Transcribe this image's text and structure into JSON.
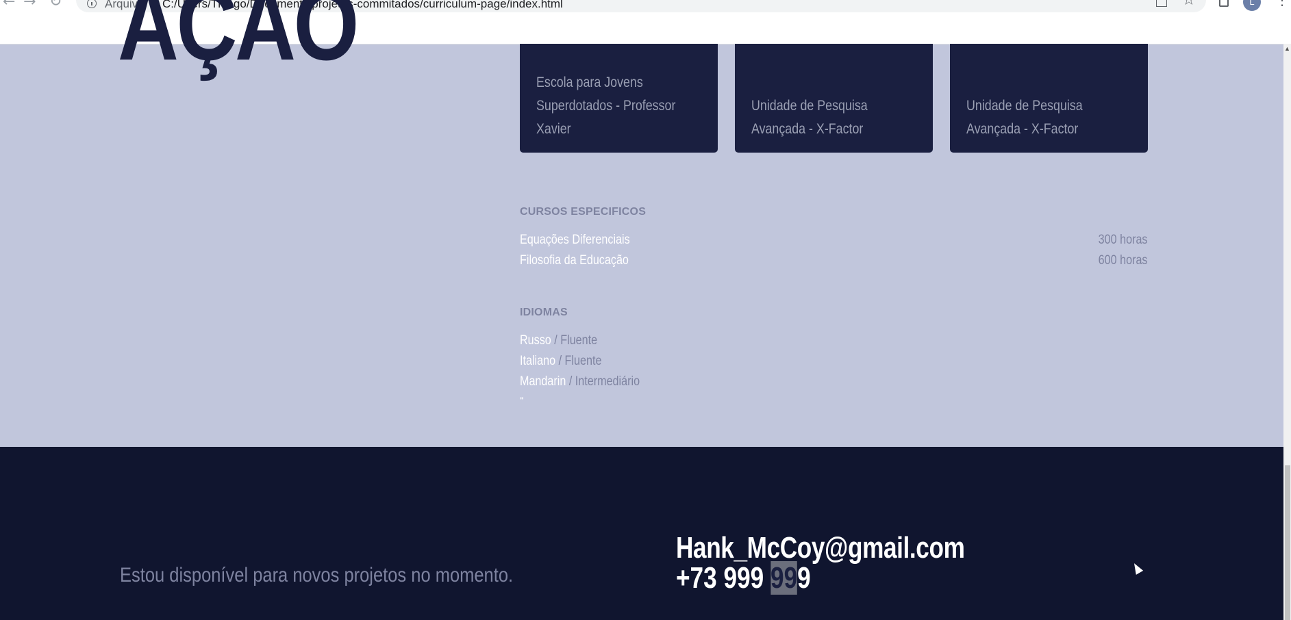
{
  "browser": {
    "scheme_label": "Arquivo",
    "separator": "|",
    "url": "C:/Users/Thiago/Documents/projetos-commitados/curriculum-page/index.html",
    "avatar_letter": "L",
    "back_glyph": "←",
    "forward_glyph": "→",
    "reload_glyph": "↻",
    "star_glyph": "☆",
    "menu_glyph": "⋮"
  },
  "main": {
    "heading": "AÇÃO",
    "cards": [
      {
        "lines": [
          "Escola para Jovens",
          "Superdotados - Professor",
          "Xavier"
        ]
      },
      {
        "lines": [
          "Unidade de Pesquisa",
          "Avançada - X-Factor"
        ]
      },
      {
        "lines": [
          "Unidade de Pesquisa",
          "Avançada - X-Factor"
        ]
      }
    ],
    "courses_title": "CURSOS ESPECIFICOS",
    "courses": [
      {
        "name": "Equações Diferenciais",
        "hours": "300 horas"
      },
      {
        "name": "Filosofia da Educação",
        "hours": "600 horas"
      }
    ],
    "languages_title": "IDIOMAS",
    "languages": [
      {
        "name": "Russo",
        "sep": " / ",
        "level": "Fluente"
      },
      {
        "name": "Italiano",
        "sep": " / ",
        "level": "Fluente"
      },
      {
        "name": "Mandarin",
        "sep": " / ",
        "level": "Intermediário"
      }
    ],
    "stray_mark": "\""
  },
  "footer": {
    "availability": "Estou disponível para novos projetos no momento.",
    "email": "Hank_McCoy@gmail.com",
    "phone_prefix": "+73 999 ",
    "phone_selected": "99",
    "phone_suffix": "9"
  }
}
